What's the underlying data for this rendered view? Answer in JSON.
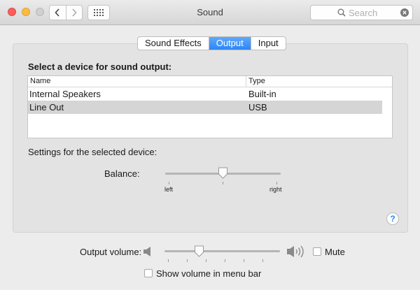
{
  "window": {
    "title": "Sound"
  },
  "search": {
    "placeholder": "Search"
  },
  "tabs": [
    {
      "label": "Sound Effects",
      "active": false
    },
    {
      "label": "Output",
      "active": true
    },
    {
      "label": "Input",
      "active": false
    }
  ],
  "output": {
    "heading": "Select a device for sound output:",
    "columns": {
      "name": "Name",
      "type": "Type"
    },
    "devices": [
      {
        "name": "Internal Speakers",
        "type": "Built-in",
        "selected": false
      },
      {
        "name": "Line Out",
        "type": "USB",
        "selected": true
      }
    ],
    "settings_label": "Settings for the selected device:",
    "balance": {
      "label": "Balance:",
      "left_label": "left",
      "right_label": "right",
      "value": 0.5
    },
    "help_label": "?"
  },
  "volume": {
    "label": "Output volume:",
    "value": 0.33,
    "mute_label": "Mute",
    "mute_checked": false,
    "menu_bar_label": "Show volume in menu bar",
    "menu_bar_checked": false
  },
  "colors": {
    "accent": "#2d85f8",
    "close": "#fc605c",
    "minimize": "#fdbc40"
  }
}
